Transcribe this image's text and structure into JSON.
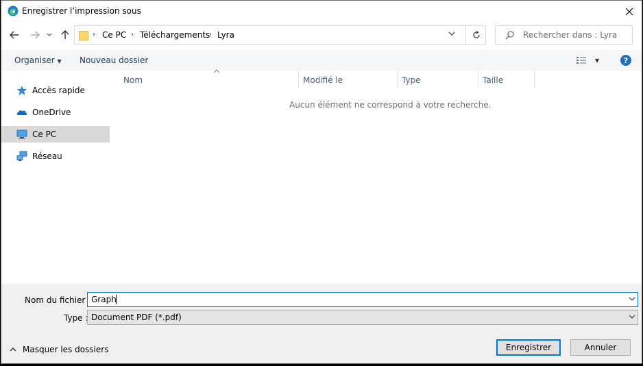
{
  "window": {
    "title": "Enregistrer l’impression sous"
  },
  "address": {
    "crumbs": [
      "Ce PC",
      "Téléchargements",
      "Lyra"
    ]
  },
  "search": {
    "placeholder": "Rechercher dans : Lyra"
  },
  "toolbar": {
    "organize": "Organiser",
    "new_folder": "Nouveau dossier"
  },
  "sidebar": {
    "items": [
      {
        "label": "Accès rapide",
        "icon": "star-icon"
      },
      {
        "label": "OneDrive",
        "icon": "cloud-icon"
      },
      {
        "label": "Ce PC",
        "icon": "computer-icon",
        "selected": true
      },
      {
        "label": "Réseau",
        "icon": "network-icon"
      }
    ]
  },
  "columns": [
    "Nom",
    "Modifié le",
    "Type",
    "Taille"
  ],
  "empty_message": "Aucun élément ne correspond à votre recherche.",
  "file": {
    "name_label": "Nom du fichier :",
    "name_value": "Graph",
    "type_label": "Type :",
    "type_value": "Document PDF (*.pdf)"
  },
  "footer": {
    "hide_folders": "Masquer les dossiers",
    "save": "Enregistrer",
    "cancel": "Annuler"
  },
  "colors": {
    "accent": "#0078d7",
    "toolbar_bg": "#f4f6f8",
    "selected_bg": "#d9d9d9"
  }
}
